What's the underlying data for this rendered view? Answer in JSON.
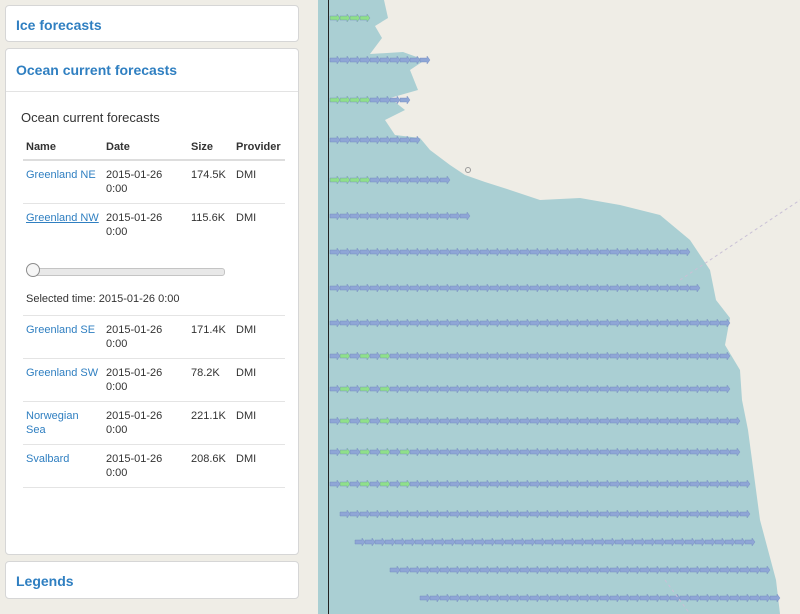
{
  "panels": {
    "ice": {
      "title": "Ice forecasts"
    },
    "ocean": {
      "title": "Ocean current forecasts"
    },
    "legends": {
      "title": "Legends"
    }
  },
  "ocean": {
    "subtitle": "Ocean current forecasts",
    "columns": [
      "Name",
      "Date",
      "Size",
      "Provider"
    ],
    "rows": [
      {
        "name": "Greenland NE",
        "date": "2015-01-26 0:00",
        "size": "174.5K",
        "provider": "DMI"
      },
      {
        "name": "Greenland NW",
        "date": "2015-01-26 0:00",
        "size": "115.6K",
        "provider": "DMI"
      },
      {
        "name": "Greenland SE",
        "date": "2015-01-26 0:00",
        "size": "171.4K",
        "provider": "DMI"
      },
      {
        "name": "Greenland SW",
        "date": "2015-01-26 0:00",
        "size": "78.2K",
        "provider": "DMI"
      },
      {
        "name": "Norwegian Sea",
        "date": "2015-01-26 0:00",
        "size": "221.1K",
        "provider": "DMI"
      },
      {
        "name": "Svalbard",
        "date": "2015-01-26 0:00",
        "size": "208.6K",
        "provider": "DMI"
      }
    ],
    "slider": {
      "label": "Selected time: 2015-01-26 0:00",
      "position": 0
    }
  },
  "colors": {
    "land": "#efede6",
    "sea": "#aacfd3",
    "arrow": "#8fa6d6",
    "arrow_highlight": "#8fe08a",
    "link": "#2f7fc1"
  }
}
